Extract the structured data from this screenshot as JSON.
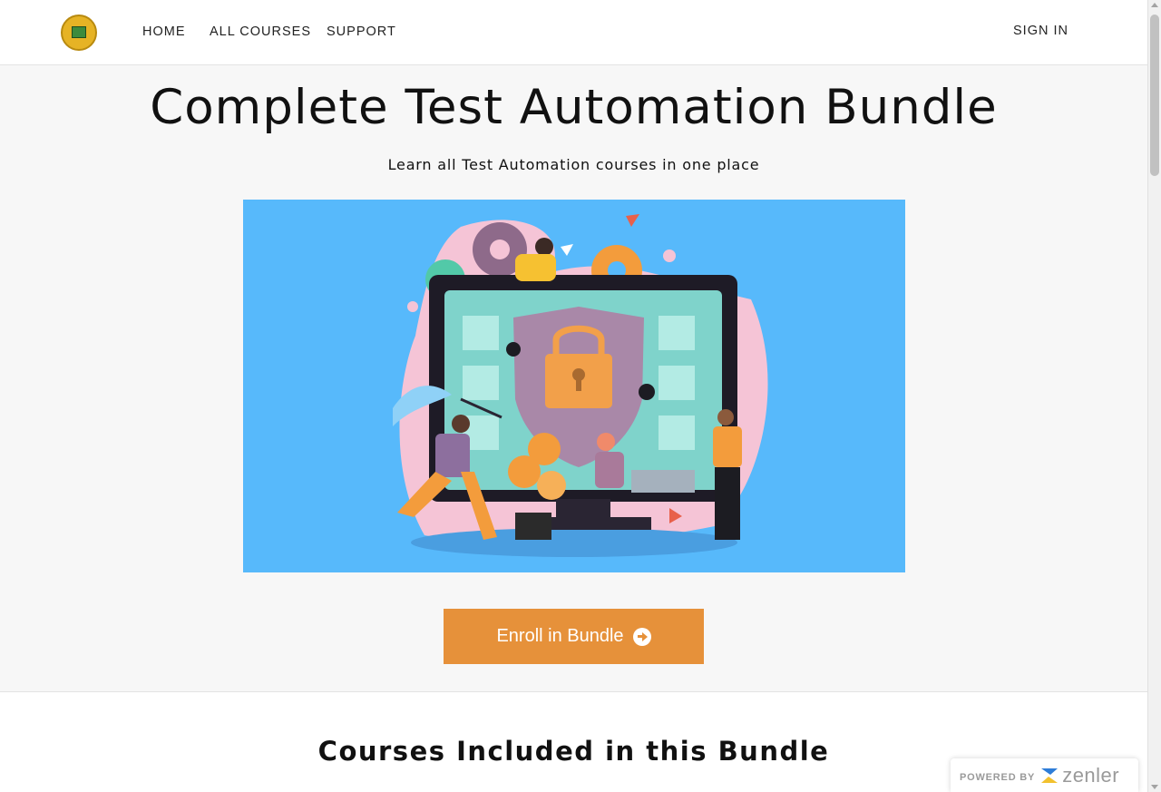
{
  "nav": {
    "logo_alt": "Test Automation logo",
    "links": [
      {
        "label": "HOME"
      },
      {
        "label": "ALL COURSES"
      },
      {
        "label": "SUPPORT"
      }
    ],
    "sign_in_label": "SIGN IN"
  },
  "hero": {
    "title": "Complete Test Automation Bundle",
    "subtitle": "Learn all Test Automation courses in one place",
    "image_icon": "security-illustration-icon",
    "enroll_label": "Enroll in Bundle",
    "enroll_icon": "arrow-circle-right-icon"
  },
  "courses": {
    "title": "Courses Included in this Bundle"
  },
  "footer_badge": {
    "powered_label": "POWERED BY",
    "brand": "zenler"
  },
  "colors": {
    "accent": "#e6913a",
    "hero_image_bg": "#57b9fb",
    "page_bg": "#f7f7f7"
  }
}
